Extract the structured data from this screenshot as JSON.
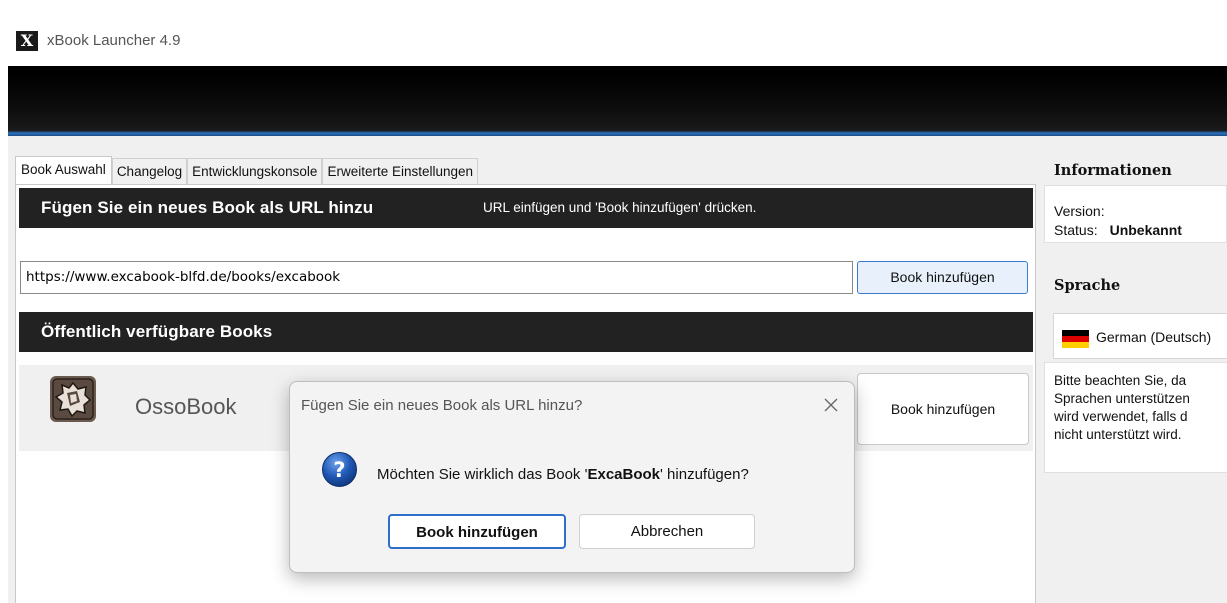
{
  "window": {
    "title": "xBook Launcher 4.9",
    "icon_letter": "X"
  },
  "tabs": [
    {
      "label": "Book Auswahl",
      "active": true
    },
    {
      "label": "Changelog",
      "active": false
    },
    {
      "label": "Entwicklungskonsole",
      "active": false
    },
    {
      "label": "Erweiterte Einstellungen",
      "active": false
    }
  ],
  "add_url_section": {
    "heading": "Fügen Sie ein neues Book als URL hinzu",
    "hint": "URL einfügen und 'Book hinzufügen' drücken.",
    "url_value": "https://www.excabook-blfd.de/books/excabook",
    "button_label": "Book hinzufügen"
  },
  "public_books": {
    "heading": "Öffentlich verfügbare Books",
    "items": [
      {
        "name": "OssoBook",
        "button_label": "Book hinzufügen"
      }
    ]
  },
  "info": {
    "title": "Informationen",
    "version_label": "Version:",
    "status_label": "Status:",
    "status_value": "Unbekannt"
  },
  "language": {
    "title": "Sprache",
    "selected": "German (Deutsch)",
    "note_lines": [
      "Bitte beachten Sie, da",
      "Sprachen unterstützen",
      "wird verwendet, falls d",
      "nicht unterstützt wird."
    ]
  },
  "dialog": {
    "title": "Fügen Sie ein neues Book als URL hinzu?",
    "message_prefix": "Möchten Sie wirklich das Book '",
    "message_book": "ExcaBook",
    "message_suffix": "' hinzufügen?",
    "confirm_label": "Book hinzufügen",
    "cancel_label": "Abbrechen"
  },
  "colors": {
    "banner": "#000000",
    "banner_accent": "#2d73c2",
    "section_bar": "#222222",
    "focus_blue": "#2c6ec9",
    "question_icon": "#1f57b5"
  }
}
